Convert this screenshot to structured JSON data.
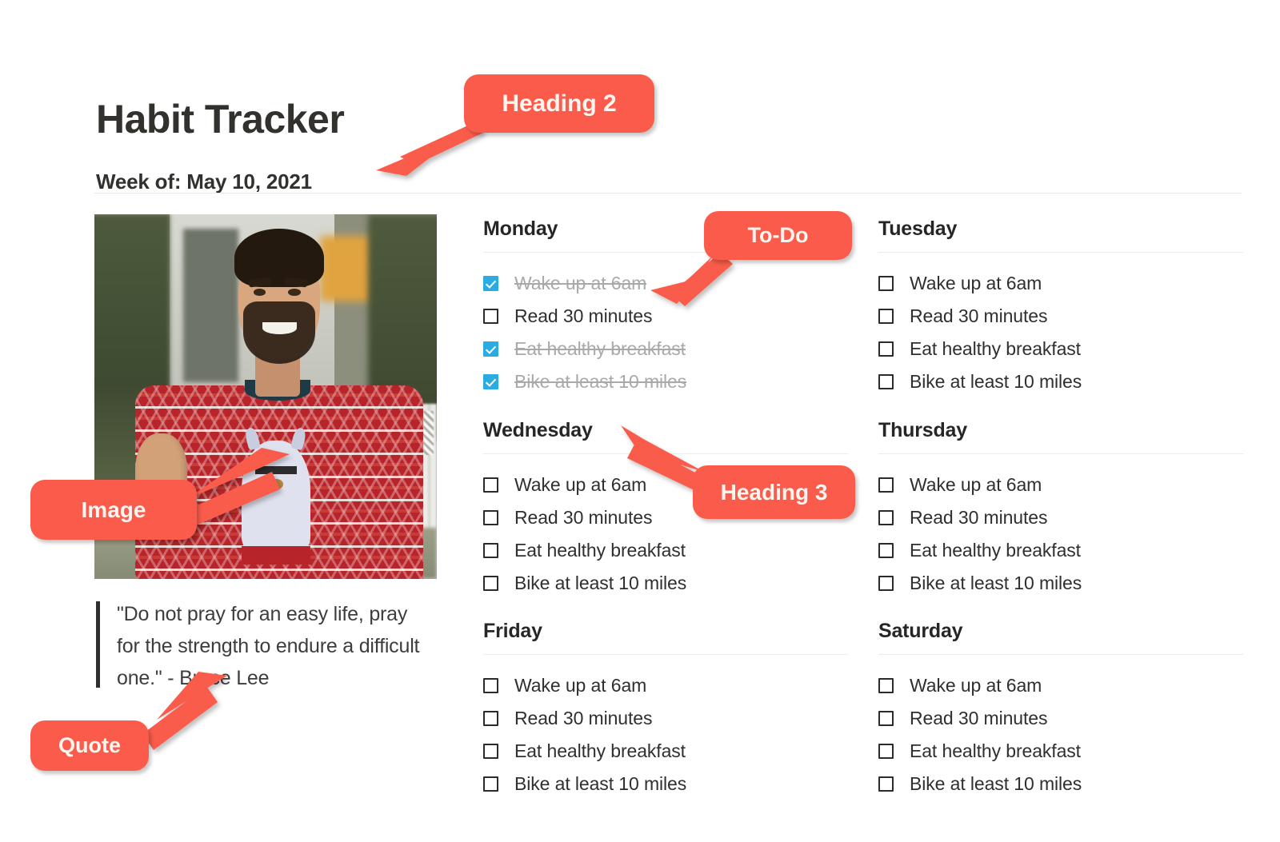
{
  "page": {
    "title": "Habit Tracker",
    "subtitle": "Week of: May 10, 2021",
    "accent_color": "#fa5b4b",
    "checkbox_checked_color": "#2aabe2",
    "text_color": "#2f2f2f",
    "done_text_color": "#a9a9a9",
    "divider_color": "#ececec"
  },
  "image": {
    "alt": "Smiling bearded man giving a thumbs up while wearing a red llama holiday sweater",
    "icon": "photo-icon"
  },
  "quote": {
    "text": "\"Do not pray for an easy life, pray for the strength to endure a difficult one.\" - Bruce Lee"
  },
  "days": [
    {
      "name": "Monday",
      "column": "left",
      "tasks": [
        {
          "label": "Wake up at 6am",
          "done": true
        },
        {
          "label": "Read 30 minutes",
          "done": false
        },
        {
          "label": "Eat healthy breakfast",
          "done": true
        },
        {
          "label": "Bike at least 10 miles",
          "done": true
        }
      ]
    },
    {
      "name": "Tuesday",
      "column": "right",
      "tasks": [
        {
          "label": "Wake up at 6am",
          "done": false
        },
        {
          "label": "Read 30 minutes",
          "done": false
        },
        {
          "label": "Eat healthy breakfast",
          "done": false
        },
        {
          "label": "Bike at least 10 miles",
          "done": false
        }
      ]
    },
    {
      "name": "Wednesday",
      "column": "left",
      "tasks": [
        {
          "label": "Wake up at 6am",
          "done": false
        },
        {
          "label": "Read 30 minutes",
          "done": false
        },
        {
          "label": "Eat healthy breakfast",
          "done": false
        },
        {
          "label": "Bike at least 10 miles",
          "done": false
        }
      ]
    },
    {
      "name": "Thursday",
      "column": "right",
      "tasks": [
        {
          "label": "Wake up at 6am",
          "done": false
        },
        {
          "label": "Read 30 minutes",
          "done": false
        },
        {
          "label": "Eat healthy breakfast",
          "done": false
        },
        {
          "label": "Bike at least 10 miles",
          "done": false
        }
      ]
    },
    {
      "name": "Friday",
      "column": "left",
      "tasks": [
        {
          "label": "Wake up at 6am",
          "done": false
        },
        {
          "label": "Read 30 minutes",
          "done": false
        },
        {
          "label": "Eat healthy breakfast",
          "done": false
        },
        {
          "label": "Bike at least 10 miles",
          "done": false
        }
      ]
    },
    {
      "name": "Saturday",
      "column": "right",
      "tasks": [
        {
          "label": "Wake up at 6am",
          "done": false
        },
        {
          "label": "Read 30 minutes",
          "done": false
        },
        {
          "label": "Eat healthy breakfast",
          "done": false
        },
        {
          "label": "Bike at least 10 miles",
          "done": false
        }
      ]
    }
  ],
  "annotations": [
    {
      "label": "Heading 2",
      "target": "subtitle"
    },
    {
      "label": "To-Do",
      "target": "monday-first-task"
    },
    {
      "label": "Heading 3",
      "target": "wednesday-heading"
    },
    {
      "label": "Image",
      "target": "photo"
    },
    {
      "label": "Quote",
      "target": "quote-block"
    }
  ]
}
